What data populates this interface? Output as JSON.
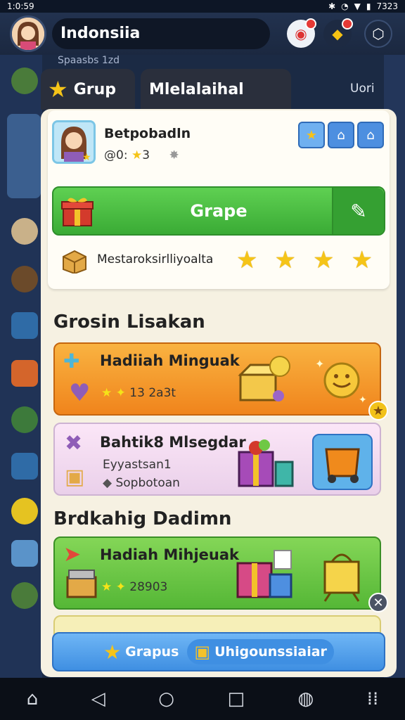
{
  "status_bar": {
    "time": "1:0:59",
    "right_text": "7323"
  },
  "top_bar": {
    "search_text": "Indonsiia"
  },
  "background": {
    "caption": "Spaasbs 1zd"
  },
  "tabs": [
    {
      "label": "Grup",
      "icon": "star-icon"
    },
    {
      "label": "Mlelalaihal"
    }
  ],
  "tab_right_label": "Uori",
  "profile": {
    "name": "Betpobadln",
    "sub_text": "@0: ",
    "sub_count": "3",
    "action_icons": [
      "star-icon",
      "home-icon",
      "home-icon"
    ]
  },
  "primary_button": {
    "label": "Grape",
    "edit_icon": "pencil-icon"
  },
  "rating": {
    "label": "Mestaroksirlliyoalta",
    "stars": 4
  },
  "sections": [
    {
      "title": "Grosin Lisakan",
      "cards": [
        {
          "title": "Hadiiah Minguak",
          "sub": "13 2a3t",
          "color": "#f59a2a"
        },
        {
          "title": "Bahtik8 Mlsegdar",
          "sub_a": "Eyyastsan1",
          "sub_b": "Sopbotoan",
          "color": "#f3d9f0"
        }
      ]
    },
    {
      "title": "Brdkahig Dadimn",
      "cards": [
        {
          "title": "Hadiah Mihjeuak",
          "sub": "28903",
          "color": "#6fc844"
        }
      ]
    }
  ],
  "bottom_actions": {
    "left_label": "Grapus",
    "right_label": "Uhigounssiaiar"
  },
  "colors": {
    "accent_green": "#3aab35",
    "accent_blue": "#3f8fe2",
    "accent_orange": "#f59a2a",
    "star": "#f5c418"
  }
}
